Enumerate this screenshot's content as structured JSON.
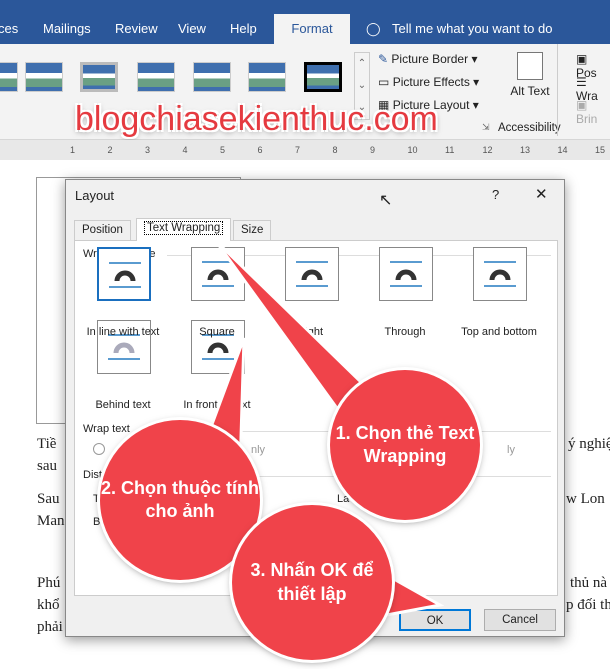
{
  "ribbon": {
    "tabs": [
      "ces",
      "Mailings",
      "Review",
      "View",
      "Help"
    ],
    "active_tab": "Format",
    "tell_me": "Tell me what you want to do",
    "picture_border": "Picture Border",
    "picture_effects": "Picture Effects",
    "picture_layout": "Picture Layout",
    "alt_text": "Alt Text",
    "accessibility": "Accessibility",
    "position": "Pos",
    "wrap": "Wra",
    "bring": "Brin"
  },
  "watermark": "blogchiasekienthuc.com",
  "ruler_numbers": [
    "1",
    "2",
    "3",
    "4",
    "5",
    "6",
    "7",
    "8",
    "9",
    "10",
    "11",
    "12",
    "13",
    "14",
    "15"
  ],
  "document": {
    "lines": [
      "Tiề",
      "ý nghiệ",
      "sau",
      "Sau",
      "w Lon",
      "Man",
      "Phú",
      "thủ nà",
      "khổ",
      "p đối th",
      "phải"
    ]
  },
  "dialog": {
    "title": "Layout",
    "help": "?",
    "close": "✕",
    "tabs": [
      "Position",
      "Text Wrapping",
      "Size"
    ],
    "active_tab": "Text Wrapping",
    "wrapping_style_label": "Wrapping style",
    "styles": [
      "In line with text",
      "Square",
      "Tight",
      "Through",
      "Top and bottom",
      "Behind text",
      "In front of text"
    ],
    "selected_style": "In line with text",
    "wrap_text_label": "Wrap text",
    "wrap_opts": [
      "nly",
      "ly"
    ],
    "distance_label": "Distance from text",
    "top": "T",
    "bottom": "Bo",
    "left": "La",
    "ok": "OK",
    "cancel": "Cancel"
  },
  "callouts": [
    "1. Chọn thẻ Text Wrapping",
    "2. Chọn thuộc tính cho ảnh",
    "3. Nhấn OK để thiết lập"
  ],
  "colors": {
    "word_blue": "#2b579a",
    "callout_red": "#f0434a"
  }
}
